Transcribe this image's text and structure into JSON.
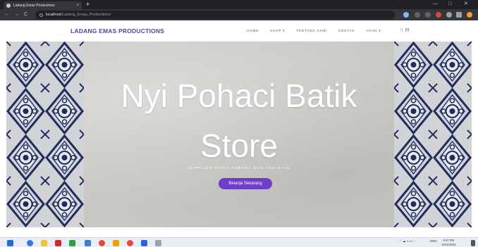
{
  "browser": {
    "tab_title": "Ladang Emas Productions",
    "tab_close": "×",
    "new_tab": "+",
    "url_host": "localhost",
    "url_path": "/Ladang_Emas_Productions/",
    "back_icon": "arrow-left-icon",
    "forward_icon": "arrow-right-icon",
    "reload_icon": "reload-icon"
  },
  "site": {
    "brand": "LADANG EMAS PRODUCTIONS",
    "menu": [
      "HOME",
      "SHOP ▾",
      "TENTANG KAMI",
      "KONTAK",
      "AKUN ▾"
    ],
    "cart": "🛒 [0]",
    "brand_color": "#5b3ea4"
  },
  "hero": {
    "title_line1": "Nyi Pohaci Batik",
    "title_line2": "Store",
    "subtitle": "SUPPLIER BATIK TRENDY DAN KEKINIAN",
    "cta": "Belanja Sekarang",
    "cta_color": "#6f3ec9"
  },
  "taskbar": {
    "tray_lang": "ENG",
    "time": "8:47 PM",
    "date": "11/11/2022"
  }
}
